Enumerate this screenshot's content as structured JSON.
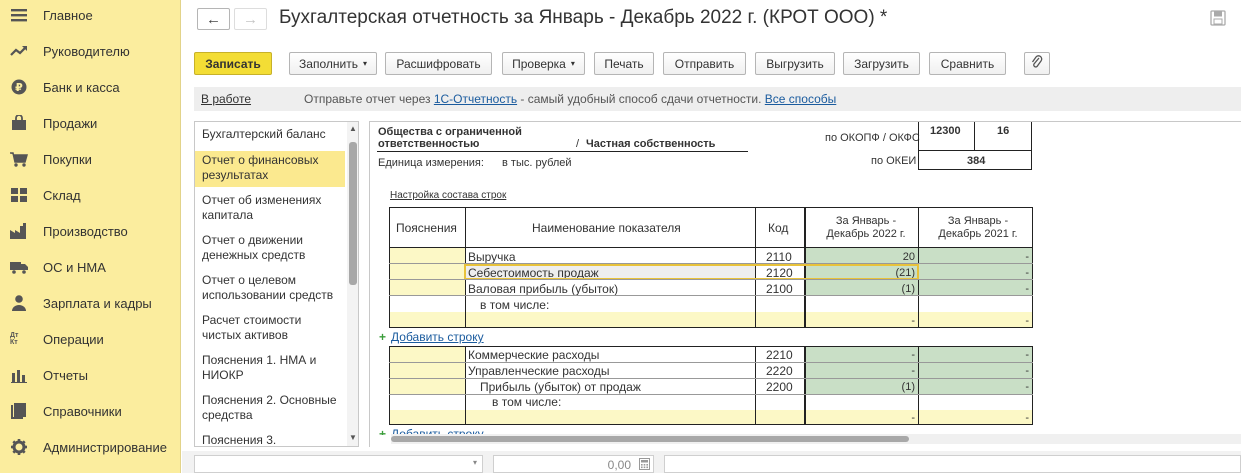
{
  "sidebar": {
    "items": [
      {
        "label": "Главное",
        "icon": "menu-icon"
      },
      {
        "label": "Руководителю",
        "icon": "trend-icon"
      },
      {
        "label": "Банк и касса",
        "icon": "ruble-icon"
      },
      {
        "label": "Продажи",
        "icon": "bag-icon"
      },
      {
        "label": "Покупки",
        "icon": "cart-icon"
      },
      {
        "label": "Склад",
        "icon": "warehouse-icon"
      },
      {
        "label": "Производство",
        "icon": "factory-icon"
      },
      {
        "label": "ОС и НМА",
        "icon": "truck-icon"
      },
      {
        "label": "Зарплата и кадры",
        "icon": "person-icon"
      },
      {
        "label": "Операции",
        "icon": "dt-kt-icon"
      },
      {
        "label": "Отчеты",
        "icon": "bar-chart-icon"
      },
      {
        "label": "Справочники",
        "icon": "book-icon"
      },
      {
        "label": "Администрирование",
        "icon": "gear-icon"
      }
    ],
    "dt_kt_glyph": "Дт Кт"
  },
  "header": {
    "title": "Бухгалтерская отчетность за Январь - Декабрь 2022 г. (КРОТ ООО) *",
    "back_glyph": "←",
    "forward_glyph": "→"
  },
  "toolbar": {
    "save": "Записать",
    "fill": "Заполнить",
    "decode": "Расшифровать",
    "check": "Проверка",
    "print": "Печать",
    "send": "Отправить",
    "export": "Выгрузить",
    "import": "Загрузить",
    "compare": "Сравнить",
    "dropdown_glyph": "▾",
    "accent_color": "#f3dd35"
  },
  "infobar": {
    "status": "В работе",
    "msg_prefix": "Отправьте отчет через ",
    "msg_link": "1С-Отчетность",
    "msg_middle": " - самый удобный способ сдачи отчетности. ",
    "msg_link2": "Все способы"
  },
  "report_list": {
    "items": [
      "Бухгалтерский баланс",
      "Отчет о финансовых результатах",
      "Отчет об изменениях капитала",
      "Отчет о движении денежных средств",
      "Отчет о целевом использовании средств",
      "Расчет стоимости чистых активов",
      "Пояснения 1. НМА и НИОКР",
      "Пояснения 2. Основные средства",
      "Пояснения 3."
    ],
    "selected_index": 1
  },
  "form": {
    "org_form_line1": "Общества с ограниченной",
    "org_form_line2": "ответственностью",
    "slash": "/",
    "ownership": "Частная собственность",
    "okopf_label": "по ОКОПФ / ОКФС",
    "okopf": "12300",
    "okfs": "16",
    "unit_label": "Единица измерения:",
    "unit": "в тыс. рублей",
    "okei_label": "по ОКЕИ",
    "okei": "384",
    "row_settings_link": "Настройка состава строк",
    "col_notes": "Пояснения",
    "col_name": "Наименование показателя",
    "col_code": "Код",
    "col_cur": "За Январь - Декабрь 2022 г.",
    "col_prev": "За Январь - Декабрь 2021 г.",
    "rows_a": [
      {
        "name": "Выручка",
        "code": "2110",
        "cur": "20",
        "prev": "-"
      },
      {
        "name": "Себестоимость продаж",
        "code": "2120",
        "cur": "(21)",
        "prev": "-"
      },
      {
        "name": "Валовая прибыль (убыток)",
        "code": "2100",
        "cur": "(1)",
        "prev": "-"
      },
      {
        "name": "в том числе:",
        "code": "",
        "cur": "-",
        "prev": "-"
      }
    ],
    "add_row": "Добавить строку",
    "rows_b": [
      {
        "name": "Коммерческие расходы",
        "code": "2210",
        "cur": "-",
        "prev": "-"
      },
      {
        "name": "Управленческие расходы",
        "code": "2220",
        "cur": "-",
        "prev": "-"
      },
      {
        "name": "Прибыль (убыток) от продаж",
        "code": "2200",
        "cur": "(1)",
        "prev": "-"
      },
      {
        "name": "в том числе:",
        "code": "",
        "cur": "-",
        "prev": "-"
      }
    ],
    "add_row_cut": "Добавить строку"
  },
  "footer": {
    "amount": "0,00"
  }
}
